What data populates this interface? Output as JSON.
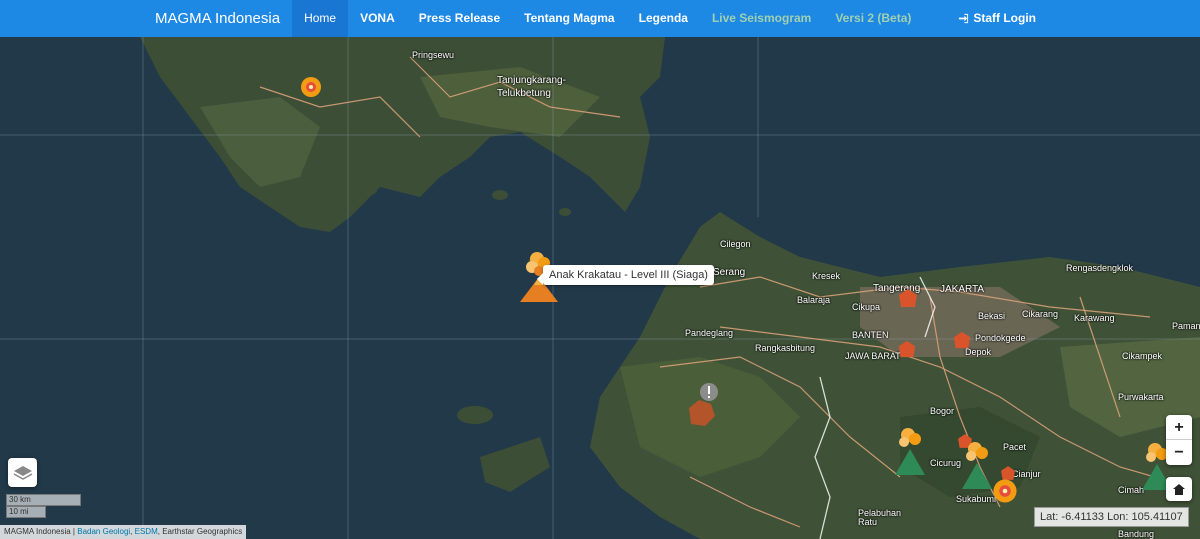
{
  "navbar": {
    "brand": "MAGMA Indonesia",
    "items": [
      {
        "label": "Home"
      },
      {
        "label": "VONA"
      },
      {
        "label": "Press Release"
      },
      {
        "label": "Tentang Magma"
      },
      {
        "label": "Legenda"
      },
      {
        "label": "Live Seismogram"
      },
      {
        "label": "Versi 2 (Beta)"
      }
    ],
    "staff_login": "Staff Login"
  },
  "map": {
    "places": {
      "pringsewu": "Pringsewu",
      "tanjungkarang": "Tanjungkarang-",
      "telukbetung": "Telukbetung",
      "cilegon": "Cilegon",
      "serang": "Serang",
      "kresek": "Kresek",
      "balaraja": "Balaraja",
      "cikupa": "Cikupa",
      "tangerang": "Tangerang",
      "jakarta": "JAKARTA",
      "rengasdengklok": "Rengasdengklok",
      "bekasi": "Bekasi",
      "cikarang": "Cikarang",
      "karawang": "Karawang",
      "banten": "BANTEN",
      "pandeglang": "Pandeglang",
      "rangkasbitung": "Rangkasbitung",
      "jawa_barat": "JAWA BARAT",
      "depok": "Depok",
      "pondokgede": "Pondokgede",
      "pamanukan": "Pamanu",
      "cikampek": "Cikampek",
      "purwakarta": "Purwakarta",
      "bogor": "Bogor",
      "pacet": "Pacet",
      "cicurug": "Cicurug",
      "cianjur": "Cianjur",
      "sukabumi": "Sukabumi",
      "cimahi": "Cimah",
      "pelabuhan_ratu": "Pelabuhan",
      "pelabuhan_ratu2": "Ratu",
      "bandung": "Bandung"
    },
    "tooltip": "Anak Krakatau - Level III (Siaga)",
    "scale_km": "30 km",
    "scale_mi": "10 mi",
    "coords": "Lat: -6.41133 Lon: 105.41107",
    "attribution": {
      "prefix": "MAGMA Indonesia | ",
      "link1": "Badan Geologi",
      "sep": ", ",
      "link2": "ESDM",
      "suffix": ", Earthstar Geographics"
    },
    "zoom_in": "+",
    "zoom_out": "−"
  },
  "colors": {
    "navbar": "#1e88e5",
    "level_siaga": "#f39c12",
    "level_waspada": "#2e8b57",
    "level_normal": "#d9542a"
  }
}
